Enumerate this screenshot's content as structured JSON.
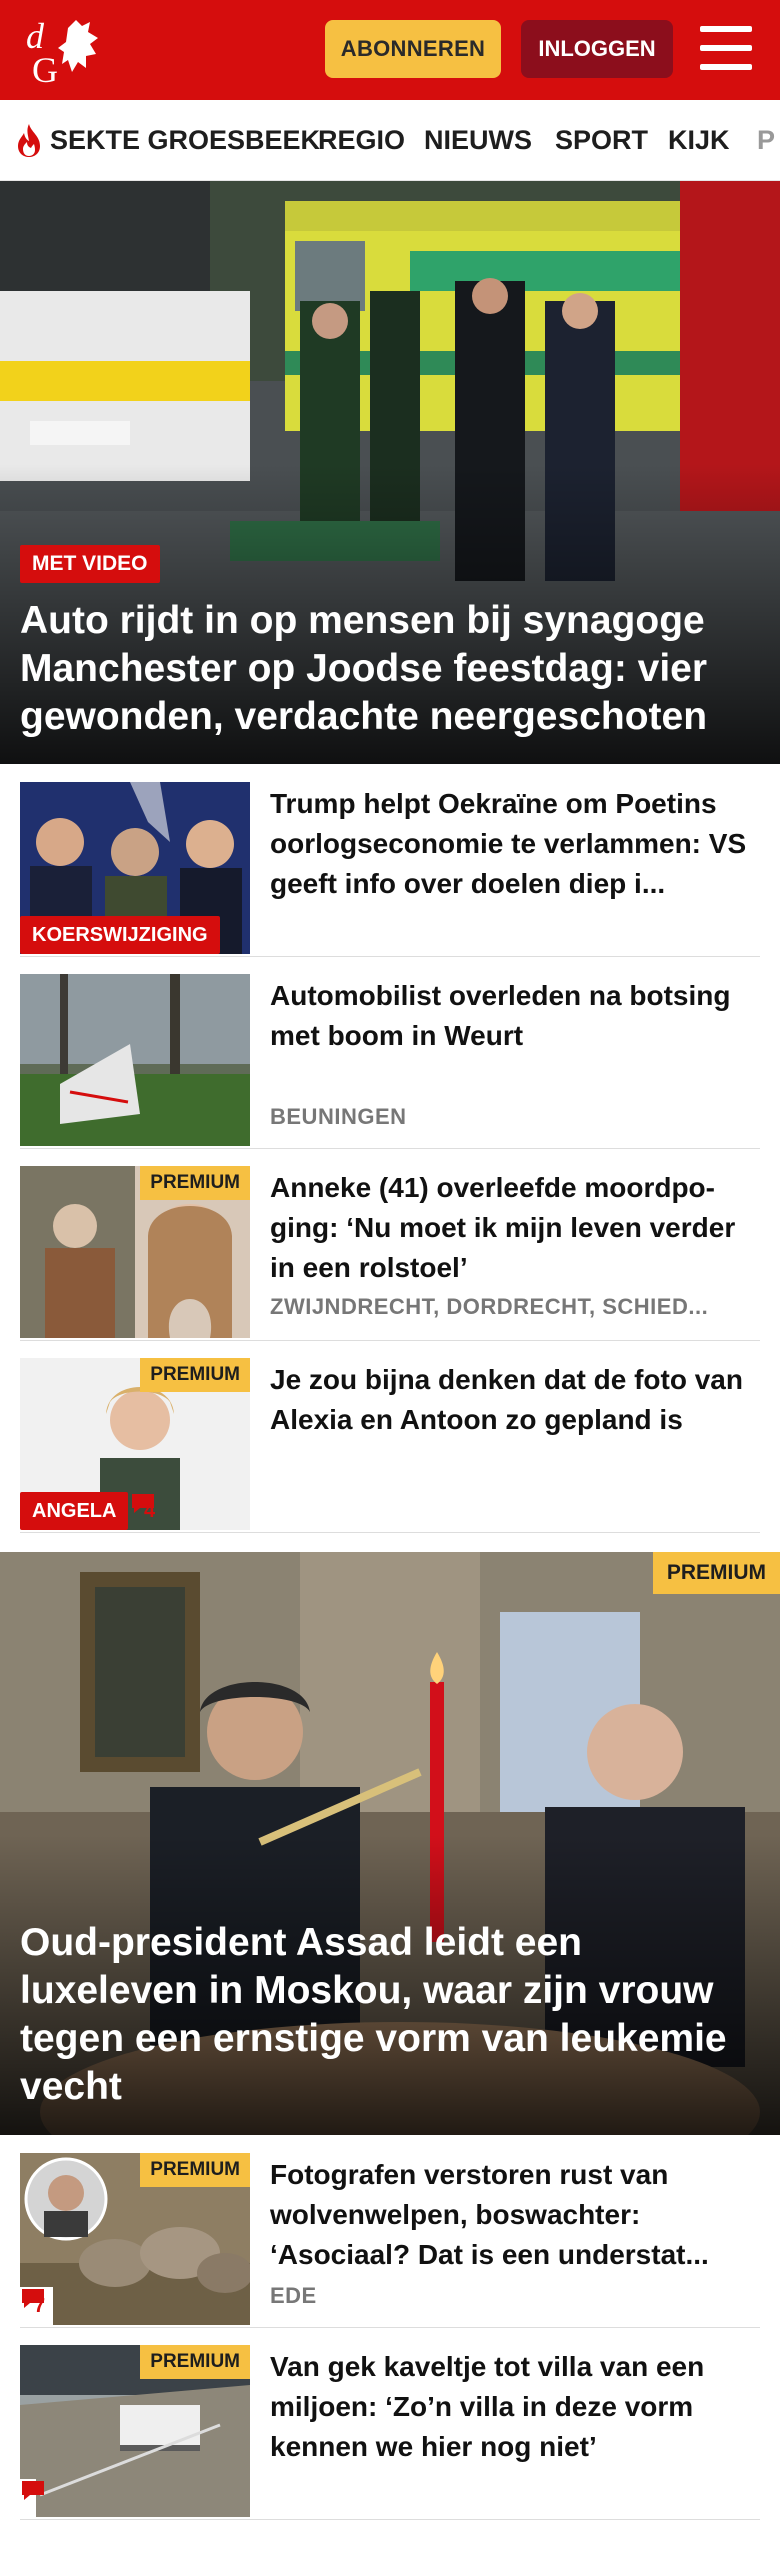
{
  "header": {
    "logo_text": "dG",
    "subscribe_label": "ABONNEREN",
    "login_label": "INLOGGEN",
    "brand_color": "#d50d0d"
  },
  "nav": {
    "items": [
      "SEKTE GROESBEEK",
      "REGIO",
      "NIEUWS",
      "SPORT",
      "KIJK",
      "P"
    ]
  },
  "hero1": {
    "label": "MET VIDEO",
    "title": "Auto rijdt in op mensen bij synagoge Manchester op Joodse feestdag: vier gewonden, verdachte neergeschoten"
  },
  "articles1": [
    {
      "title": "Trump helpt Oekraïne om Poetins oorlogseconomie te verlammen: VS geeft info over doelen diep i...",
      "label": "KOERSWIJZIGING",
      "meta": ""
    },
    {
      "title": "Automobilist overleden na botsing met boom in Weurt",
      "label": "",
      "meta": "BEUNINGEN"
    },
    {
      "title": "Anneke (41) overleefde moordpo- ging: ‘Nu moet ik mijn leven verder in een rolstoel’",
      "premium": "PREMIUM",
      "meta": "ZWIJNDRECHT, DORDRECHT, SCHIED..."
    },
    {
      "title": "Je zou bijna denken dat de foto van Alexia en Antoon zo gepland is",
      "premium": "PREMIUM",
      "label": "ANGELA",
      "comments": "4"
    }
  ],
  "hero2": {
    "premium": "PREMIUM",
    "title": "Oud-president Assad leidt een luxeleven in Moskou, waar zijn vrouw tegen een ernstige vorm van leukemie vecht"
  },
  "articles2": [
    {
      "title": "Fotografen verstoren rust van wolvenwelpen, boswachter: ‘Asociaal? Dat is een understat...",
      "premium": "PREMIUM",
      "comments": "7",
      "meta": "EDE"
    },
    {
      "title": "Van gek kaveltje tot villa van een miljoen: ‘Zo’n villa in deze vorm kennen we hier nog niet’",
      "premium": "PREMIUM",
      "comments": ""
    }
  ]
}
